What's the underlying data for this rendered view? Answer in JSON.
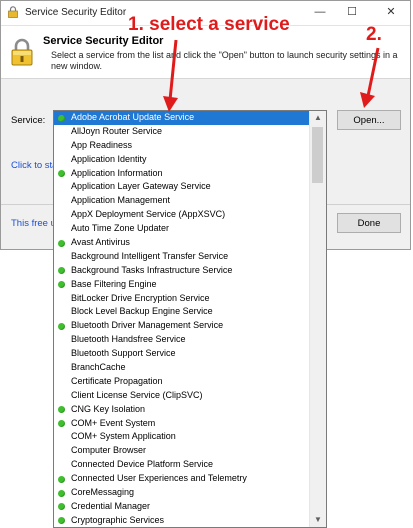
{
  "window": {
    "title": "Service Security Editor",
    "controls": {
      "minimize": "—",
      "maximize": "☐",
      "close": "✕"
    }
  },
  "header": {
    "title": "Service Security Editor",
    "description": "Select a service from the list and click the \"Open\" button to launch security settings in a new window."
  },
  "form": {
    "service_label": "Service:",
    "open_button": "Open...",
    "done_button": "Done",
    "link_partial": "Click to sta",
    "footer_partial": "This free u"
  },
  "annotations": {
    "step1": "1. select a service",
    "step2": "2.",
    "color": "#e01b1b"
  },
  "dropdown": {
    "selected_index": 0,
    "items": [
      {
        "label": "Adobe Acrobat Update Service",
        "running": true
      },
      {
        "label": "AllJoyn Router Service",
        "running": false
      },
      {
        "label": "App Readiness",
        "running": false
      },
      {
        "label": "Application Identity",
        "running": false
      },
      {
        "label": "Application Information",
        "running": true
      },
      {
        "label": "Application Layer Gateway Service",
        "running": false
      },
      {
        "label": "Application Management",
        "running": false
      },
      {
        "label": "AppX Deployment Service (AppXSVC)",
        "running": false
      },
      {
        "label": "Auto Time Zone Updater",
        "running": false
      },
      {
        "label": "Avast Antivirus",
        "running": true
      },
      {
        "label": "Background Intelligent Transfer Service",
        "running": false
      },
      {
        "label": "Background Tasks Infrastructure Service",
        "running": true
      },
      {
        "label": "Base Filtering Engine",
        "running": true
      },
      {
        "label": "BitLocker Drive Encryption Service",
        "running": false
      },
      {
        "label": "Block Level Backup Engine Service",
        "running": false
      },
      {
        "label": "Bluetooth Driver Management Service",
        "running": true
      },
      {
        "label": "Bluetooth Handsfree Service",
        "running": false
      },
      {
        "label": "Bluetooth Support Service",
        "running": false
      },
      {
        "label": "BranchCache",
        "running": false
      },
      {
        "label": "Certificate Propagation",
        "running": false
      },
      {
        "label": "Client License Service (ClipSVC)",
        "running": false
      },
      {
        "label": "CNG Key Isolation",
        "running": true
      },
      {
        "label": "COM+ Event System",
        "running": true
      },
      {
        "label": "COM+ System Application",
        "running": false
      },
      {
        "label": "Computer Browser",
        "running": false
      },
      {
        "label": "Connected Device Platform Service",
        "running": false
      },
      {
        "label": "Connected User Experiences and Telemetry",
        "running": true
      },
      {
        "label": "CoreMessaging",
        "running": true
      },
      {
        "label": "Credential Manager",
        "running": true
      },
      {
        "label": "Cryptographic Services",
        "running": true
      }
    ]
  }
}
